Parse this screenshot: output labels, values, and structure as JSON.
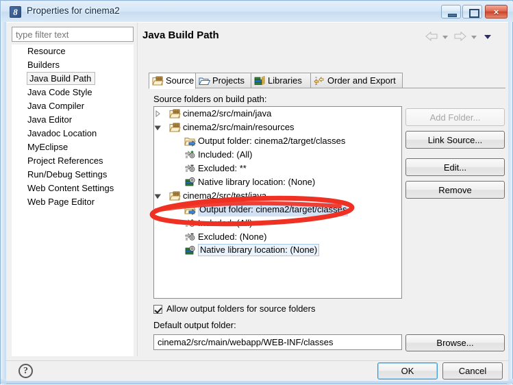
{
  "window": {
    "title": "Properties for cinema2",
    "icon": "eclipse-properties-icon",
    "minimize_label": "Minimize",
    "maximize_label": "Maximize",
    "close_label": "×"
  },
  "sidebar": {
    "filter_placeholder": "type filter text",
    "filter_value": "",
    "items": [
      {
        "label": "Resource",
        "selected": false
      },
      {
        "label": "Builders",
        "selected": false
      },
      {
        "label": "Java Build Path",
        "selected": true
      },
      {
        "label": "Java Code Style",
        "selected": false
      },
      {
        "label": "Java Compiler",
        "selected": false
      },
      {
        "label": "Java Editor",
        "selected": false
      },
      {
        "label": "Javadoc Location",
        "selected": false
      },
      {
        "label": "MyEclipse",
        "selected": false
      },
      {
        "label": "Project References",
        "selected": false
      },
      {
        "label": "Run/Debug Settings",
        "selected": false
      },
      {
        "label": "Web Content Settings",
        "selected": false
      },
      {
        "label": "Web Page Editor",
        "selected": false
      }
    ]
  },
  "page": {
    "title": "Java Build Path",
    "nav": {
      "back_icon": "back-arrow-icon",
      "back_menu_icon": "chevron-down-icon",
      "forward_icon": "forward-arrow-icon",
      "forward_menu_icon": "chevron-down-icon",
      "menu_icon": "chevron-down-filled-icon"
    },
    "tabs": [
      {
        "label": "Source",
        "icon": "package-folder-icon",
        "active": true
      },
      {
        "label": "Projects",
        "icon": "open-folder-icon",
        "active": false
      },
      {
        "label": "Libraries",
        "icon": "books-icon",
        "active": false
      },
      {
        "label": "Order and Export",
        "icon": "order-export-icon",
        "active": false
      }
    ],
    "tree_label": "Source folders on build path:",
    "tree": [
      {
        "level": 1,
        "twisty": "collapsed",
        "icon": "package-folder-icon",
        "label": "cinema2/src/main/java",
        "state": "normal"
      },
      {
        "level": 1,
        "twisty": "expanded",
        "icon": "package-folder-icon",
        "label": "cinema2/src/main/resources",
        "state": "normal"
      },
      {
        "level": 2,
        "twisty": "none",
        "icon": "output-folder-icon",
        "label": "Output folder: cinema2/target/classes",
        "state": "normal"
      },
      {
        "level": 2,
        "twisty": "none",
        "icon": "included-icon",
        "label": "Included: (All)",
        "state": "normal"
      },
      {
        "level": 2,
        "twisty": "none",
        "icon": "excluded-icon",
        "label": "Excluded: **",
        "state": "normal"
      },
      {
        "level": 2,
        "twisty": "none",
        "icon": "native-library-icon",
        "label": "Native library location: (None)",
        "state": "normal"
      },
      {
        "level": 1,
        "twisty": "expanded",
        "icon": "package-folder-icon",
        "label": "cinema2/src/test/java",
        "state": "normal"
      },
      {
        "level": 2,
        "twisty": "none",
        "icon": "output-folder-icon",
        "label": "Output folder: cinema2/target/classes",
        "state": "selected"
      },
      {
        "level": 2,
        "twisty": "none",
        "icon": "included-icon",
        "label": "Included: (All)",
        "state": "normal"
      },
      {
        "level": 2,
        "twisty": "none",
        "icon": "excluded-icon",
        "label": "Excluded: (None)",
        "state": "normal"
      },
      {
        "level": 2,
        "twisty": "none",
        "icon": "native-library-icon",
        "label": "Native library location: (None)",
        "state": "focused"
      }
    ],
    "buttons": [
      {
        "label": "Add Folder...",
        "enabled": false
      },
      {
        "label": "Link Source...",
        "enabled": true
      },
      {
        "label": "Edit...",
        "enabled": true
      },
      {
        "label": "Remove",
        "enabled": true
      }
    ],
    "allow_output_label": "Allow output folders for source folders",
    "allow_output_checked": true,
    "default_output_label": "Default output folder:",
    "default_output_value": "cinema2/src/main/webapp/WEB-INF/classes",
    "browse_label": "Browse..."
  },
  "footer": {
    "help_icon": "help-question-icon",
    "help_glyph": "?",
    "ok_label": "OK",
    "cancel_label": "Cancel"
  },
  "annotation": {
    "shape": "red-ellipse-highlight",
    "color": "#ef3124",
    "target": "Output folder: cinema2/target/classes"
  },
  "colors": {
    "selection": "#d2e2f4",
    "annotation_red": "#ef3124",
    "default_button_border": "#3c9ad6",
    "title_bar": "#d4e6f7"
  }
}
